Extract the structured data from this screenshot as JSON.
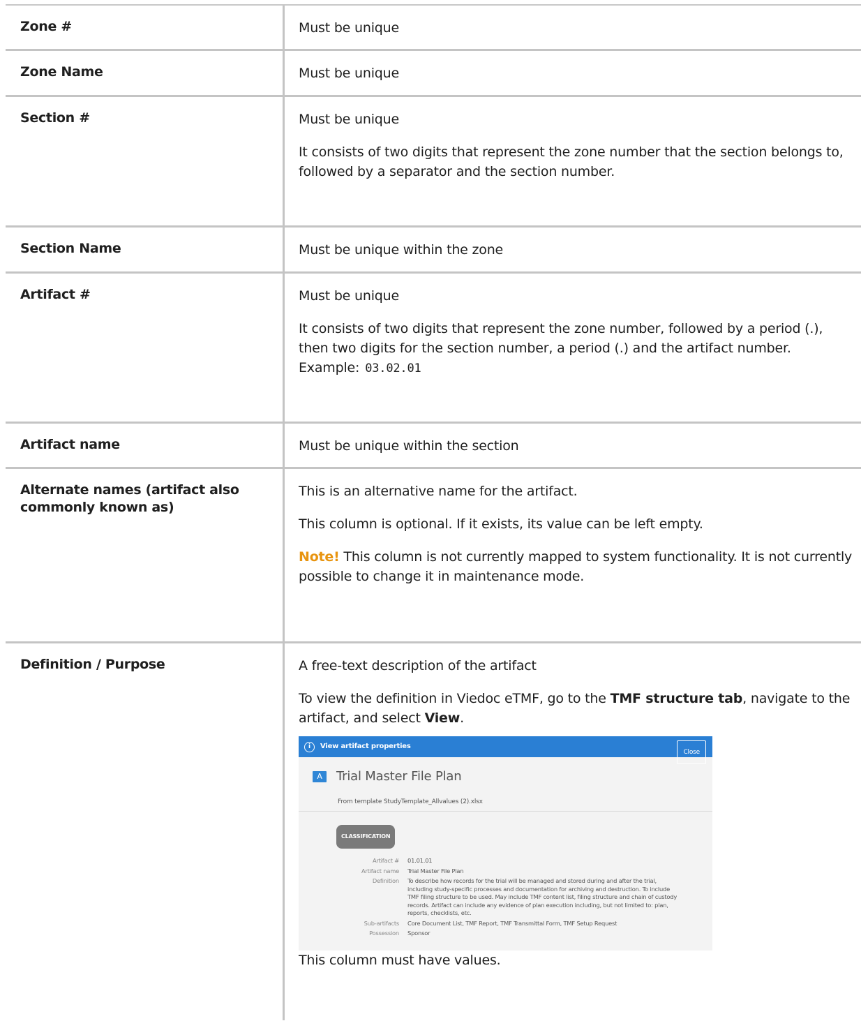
{
  "rows": [
    {
      "label": "Zone #",
      "desc": [
        "Must be unique"
      ]
    },
    {
      "label": "Zone Name",
      "desc": [
        "Must be unique"
      ]
    },
    {
      "label": "Section #",
      "desc": [
        "Must be unique",
        "It consists of two digits that represent the zone number that the section belongs to, followed by a separator and the section number."
      ]
    },
    {
      "label": "Section Name",
      "desc": [
        "Must be unique within the zone"
      ]
    },
    {
      "label": "Artifact #",
      "desc": [
        "Must be unique",
        "It consists of two digits that represent the zone number, followed by a period (.), then two digits for the section number, a period (.) and the artifact number. Example:"
      ],
      "example": "03.02.01"
    },
    {
      "label": "Artifact name",
      "desc": [
        "Must be unique within the section"
      ]
    },
    {
      "label": "Alternate names (artifact also commonly known as)",
      "desc": [
        "This is an alternative name for the artifact.",
        "This column is optional. If it exists, its value can be left empty."
      ],
      "note_label": "Note!",
      "note_text": " This column is not currently mapped to system functionality. It is not currently possible to change it in maintenance mode."
    },
    {
      "label": "Definition / Purpose",
      "desc": [
        "A free-text description of the artifact"
      ],
      "view_text_1": "To view the definition in Viedoc eTMF, go to the ",
      "view_bold_1": "TMF structure tab",
      "view_text_2": ", navigate to the artifact, and select ",
      "view_bold_2": "View",
      "view_text_3": ".",
      "after": "This column must have values."
    }
  ],
  "screenshot": {
    "bar_title": "View artifact properties",
    "close_label": "Close",
    "badge": "A",
    "title": "Trial Master File Plan",
    "subtitle": "From template StudyTemplate_Allvalues (2).xlsx",
    "section_label": "CLASSIFICATION",
    "props": [
      {
        "k": "Artifact #",
        "v": "01.01.01"
      },
      {
        "k": "Artifact name",
        "v": "Trial Master File Plan"
      },
      {
        "k": "Definition",
        "v": "To describe how records for the trial will be managed and stored during and after the trial, including study-specific processes and documentation for archiving and destruction. To include TMF filing structure to be used. May include TMF content list, filing structure and chain of custody records. Artifact can include any evidence of plan execution including, but not limited to: plan, reports, checklists, etc."
      },
      {
        "k": "Sub-artifacts",
        "v": "Core Document List, TMF Report, TMF Transmittal Form, TMF Setup Request"
      },
      {
        "k": "Possession",
        "v": "Sponsor"
      }
    ]
  }
}
